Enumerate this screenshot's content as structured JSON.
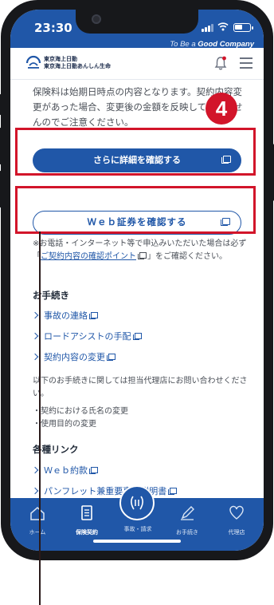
{
  "status_bar": {
    "time": "23:30"
  },
  "header": {
    "tagline_prefix": "To Be a ",
    "tagline_brand": "Good Company",
    "brand_line1": "東京海上日動",
    "brand_line2": "東京海上日動あんしん生命"
  },
  "content": {
    "note_premium": "保険料は始期日時点の内容となります。契約内容変更があった場合、変更後の金額を反映しておりませんのでご注意ください。",
    "detail_button": "さらに詳細を確認する",
    "web_cert_button": "Ｗｅｂ証券を確認する",
    "note_confirm_prefix": "※お電話・インターネット等で申込みいただいた場合は必ず「",
    "note_confirm_link": "ご契約内容の確認ポイント",
    "note_confirm_suffix": "」をご確認ください。",
    "procedures_title": "お手続き",
    "procedures": [
      "事故の連絡",
      "ロードアシストの手配",
      "契約内容の変更"
    ],
    "agent_note": "以下のお手続きに関しては担当代理店にお問い合わせください。",
    "agent_items": [
      "・契約における氏名の変更",
      "・使用目的の変更"
    ],
    "links_title": "各種リンク",
    "links": [
      "Ｗｅｂ約款",
      "パンフレット兼重要事項説明書"
    ]
  },
  "annotation": {
    "step": "4"
  },
  "tabbar": {
    "tabs": [
      "ホーム",
      "保険契約",
      "事故・請求",
      "お手続き",
      "代理店"
    ]
  },
  "colors": {
    "brand_blue": "#2057a8",
    "highlight_red": "#d2152a"
  }
}
